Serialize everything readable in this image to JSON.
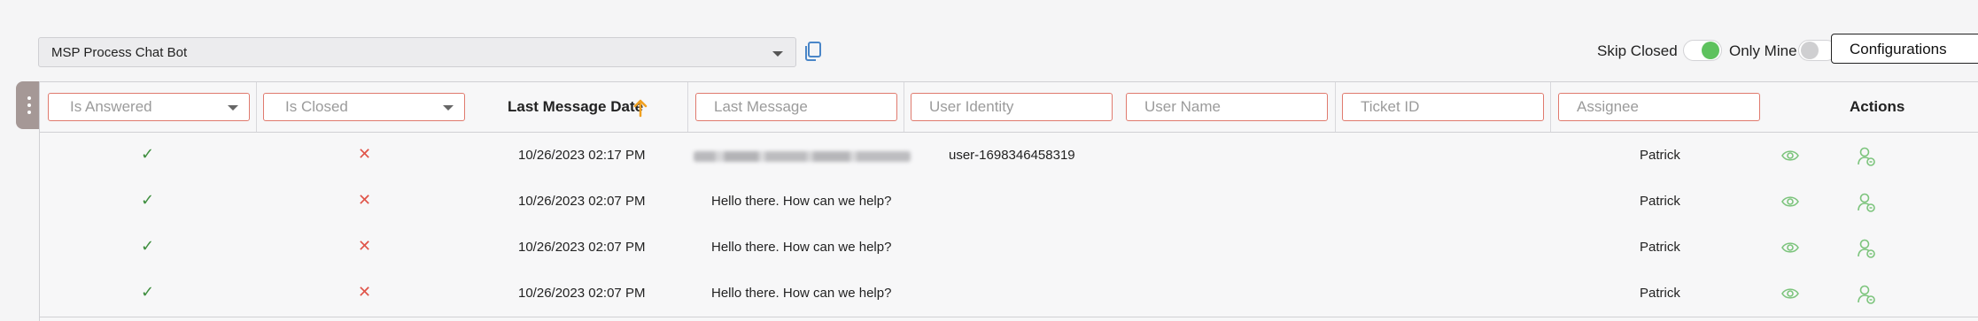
{
  "bot_select": {
    "value": "MSP Process Chat Bot"
  },
  "toolbar": {
    "skip_closed_label": "Skip Closed",
    "skip_closed_on": true,
    "only_mine_label": "Only Mine",
    "only_mine_on": false,
    "configurations_label": "Configurations"
  },
  "filters": {
    "is_answered": "Is Answered",
    "is_closed": "Is Closed",
    "last_message": "Last Message",
    "user_identity": "User Identity",
    "user_name": "User Name",
    "ticket_id": "Ticket ID",
    "assignee": "Assignee"
  },
  "columns": {
    "last_message_date": "Last Message Date",
    "actions": "Actions"
  },
  "sort": {
    "column": "Last Message Date",
    "direction": "ascending"
  },
  "rows": [
    {
      "is_answered": "✓",
      "is_closed": "✕",
      "date": "10/26/2023 02:17 PM",
      "message": "",
      "message_blurred": true,
      "user_identity": "user-1698346458319",
      "user_name": "",
      "ticket_id": "",
      "assignee": "Patrick"
    },
    {
      "is_answered": "✓",
      "is_closed": "✕",
      "date": "10/26/2023 02:07 PM",
      "message": "Hello there. How can we help?",
      "message_blurred": false,
      "user_identity": "",
      "user_name": "",
      "ticket_id": "",
      "assignee": "Patrick"
    },
    {
      "is_answered": "✓",
      "is_closed": "✕",
      "date": "10/26/2023 02:07 PM",
      "message": "Hello there. How can we help?",
      "message_blurred": false,
      "user_identity": "",
      "user_name": "",
      "ticket_id": "",
      "assignee": "Patrick"
    },
    {
      "is_answered": "✓",
      "is_closed": "✕",
      "date": "10/26/2023 02:07 PM",
      "message": "Hello there. How can we help?",
      "message_blurred": false,
      "user_identity": "",
      "user_name": "",
      "ticket_id": "",
      "assignee": "Patrick"
    }
  ],
  "icons": {
    "copy": "copy-icon",
    "sort": "arrow-up-icon",
    "view": "eye-icon",
    "assign": "user-assign-icon",
    "close": "close-icon",
    "answered": "check-icon",
    "not_closed": "x-icon"
  },
  "colors": {
    "accent_green": "#5ec25e",
    "check_green": "#3e8e3e",
    "action_green": "#7cc47c",
    "red": "#e0554a",
    "filter_border": "#e07a6e",
    "sort_arrow": "#f0a020",
    "copy_blue": "#4a86c8"
  }
}
